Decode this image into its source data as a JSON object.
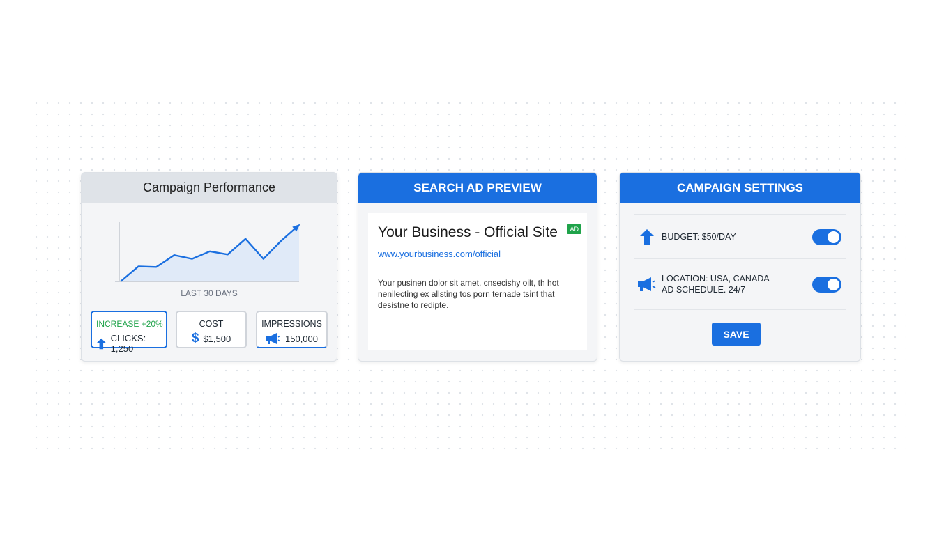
{
  "performance": {
    "title": "Campaign Performance",
    "caption": "LAST 30 DAYS",
    "chart_data": {
      "type": "area",
      "x": [
        0,
        1,
        2,
        3,
        4,
        5,
        6,
        7,
        8,
        9,
        10
      ],
      "values": [
        0,
        24,
        23,
        42,
        36,
        48,
        43,
        68,
        36,
        65,
        90
      ],
      "ylim": [
        0,
        100
      ]
    },
    "stats": {
      "clicks": {
        "change": "INCREASE +20%",
        "label": "CLICKS: 1,250"
      },
      "cost": {
        "label": "COST",
        "value": "$1,500"
      },
      "impressions": {
        "label": "IMPRESSIONS",
        "value": "150,000"
      }
    }
  },
  "ad_preview": {
    "title": "SEARCH AD PREVIEW",
    "headline": "Your Business - Official Site",
    "badge": "AD",
    "url": "www.yourbusiness.com/official",
    "description": "Your pusinen dolor sit amet, cnsecishy oilt, th hot nenilecting ex allsting tos porn ternade tsint that desistne to redipte."
  },
  "settings": {
    "title": "CAMPAIGN SETTINGS",
    "budget": "BUDGET: $50/DAY",
    "location": "LOCATION: USA, CANADA",
    "schedule": "AD SCHEDULE. 24/7",
    "save_label": "SAVE"
  },
  "colors": {
    "accent": "#1a6fe0",
    "positive": "#1fa34a"
  }
}
